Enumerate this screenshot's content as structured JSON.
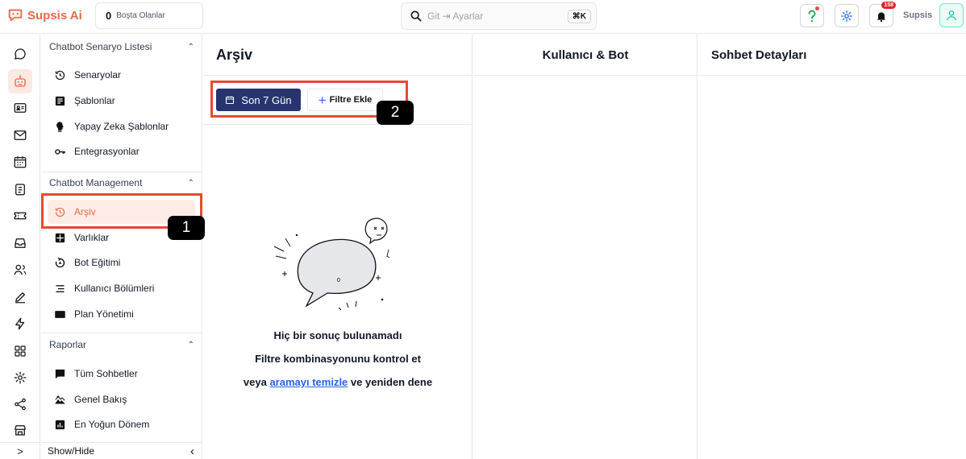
{
  "brand": {
    "name": "Supsis Ai",
    "color": "#e8684a"
  },
  "topbar": {
    "online_count": "0",
    "online_label": "Boşta Olanlar",
    "search_placeholder": "Git ⇥ Ayarlar",
    "search_shortcut": "⌘K",
    "notification_count": "158",
    "user_name": "Supsis"
  },
  "rail": {
    "icons": [
      "chat-bubble-icon",
      "robot-icon",
      "contact-card-icon",
      "mail-icon",
      "calendar-icon",
      "clipboard-icon",
      "ticket-icon",
      "inbox-icon",
      "users-icon",
      "pen-icon",
      "bolt-icon",
      "grid-icon",
      "gear-icon",
      "share-icon",
      "store-icon"
    ],
    "expand_glyph": ">"
  },
  "nav": {
    "sections": [
      {
        "title": "Chatbot Senaryo Listesi",
        "items": [
          "Senaryolar",
          "Şablonlar",
          "Yapay Zeka Şablonlar",
          "Entegrasyonlar"
        ]
      },
      {
        "title": "Chatbot Management",
        "items": [
          "Arşiv",
          "Varlıklar",
          "Bot Eğitimi",
          "Kullanıcı Bölümleri",
          "Plan Yönetimi"
        ]
      },
      {
        "title": "Raporlar",
        "items": [
          "Tüm Sohbetler",
          "Genel Bakış",
          "En Yoğun Dönem"
        ]
      }
    ],
    "active_item": "Arşiv",
    "showhide_label": "Show/Hide"
  },
  "columns": {
    "archive_title": "Arşiv",
    "user_bot_title": "Kullanıcı & Bot",
    "chat_details_title": "Sohbet Detayları"
  },
  "filters": {
    "date_label": "Son 7 Gün",
    "add_filter_label": "Filtre Ekle"
  },
  "empty_state": {
    "line1": "Hiç bir sonuç bulunamadı",
    "line2": "Filtre kombinasyonunu kontrol et",
    "line3_prefix": "veya",
    "line3_link": "aramayı temizle",
    "line3_suffix": "ve yeniden dene",
    "bubble_number": "0"
  },
  "annotations": {
    "first": "1",
    "second": "2",
    "color": "#e8492f"
  },
  "colors": {
    "primary_button": "#27346e",
    "link": "#2563eb",
    "active_bg": "#fdece6"
  }
}
